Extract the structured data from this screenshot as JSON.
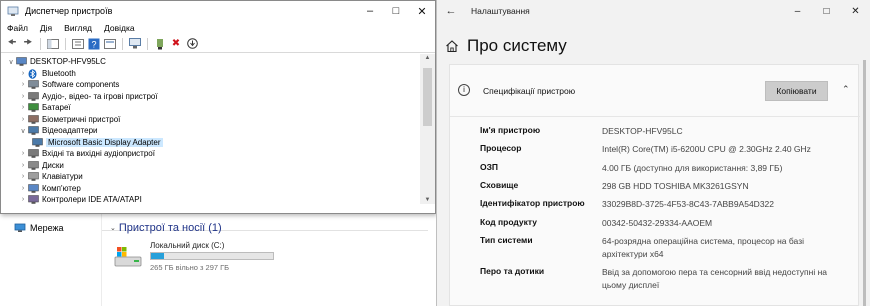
{
  "device_manager": {
    "title": "Диспетчер пристроїв",
    "menu": [
      "Файл",
      "Дія",
      "Вигляд",
      "Довідка"
    ],
    "tree": {
      "root": "DESKTOP-HFV95LC",
      "items": [
        {
          "label": "Bluetooth",
          "icon": "bluetooth-icon",
          "expanded": false
        },
        {
          "label": "Software components",
          "icon": "component-icon",
          "expanded": false
        },
        {
          "label": "Аудіо-, відео- та ігрові пристрої",
          "icon": "speaker-icon",
          "expanded": false
        },
        {
          "label": "Батареї",
          "icon": "battery-icon",
          "expanded": false
        },
        {
          "label": "Біометричні пристрої",
          "icon": "fingerprint-icon",
          "expanded": false
        },
        {
          "label": "Відеоадаптери",
          "icon": "display-adapter-icon",
          "expanded": true
        },
        {
          "label": "Microsoft Basic Display Adapter",
          "icon": "display-adapter-icon",
          "child": true,
          "selected": true
        },
        {
          "label": "Вхідні та вихідні аудіопристрої",
          "icon": "speaker-icon",
          "expanded": false
        },
        {
          "label": "Диски",
          "icon": "disk-icon",
          "expanded": false
        },
        {
          "label": "Клавіатури",
          "icon": "keyboard-icon",
          "expanded": false
        },
        {
          "label": "Комп'ютер",
          "icon": "computer-icon",
          "expanded": false
        },
        {
          "label": "Контролери IDE ATA/ATAPI",
          "icon": "controller-icon",
          "expanded": false
        }
      ]
    }
  },
  "explorer": {
    "nav_network": "Мережа",
    "group_title": "Пристрої та носії (1)",
    "drive": {
      "name": "Локальний диск (C:)",
      "free_text": "265 ГБ вільно з 297 ГБ",
      "used_fraction": 0.108
    }
  },
  "settings": {
    "window_title": "Налаштування",
    "page_title": "Про систему",
    "spec_title": "Специфікації пристрою",
    "copy_button": "Копіювати",
    "specs": [
      {
        "key": "Ім'я пристрою",
        "value": "DESKTOP-HFV95LC"
      },
      {
        "key": "Процесор",
        "value": "Intel(R) Core(TM) i5-6200U CPU @ 2.30GHz   2.40 GHz"
      },
      {
        "key": "ОЗП",
        "value": "4.00 ГБ (доступно для використання: 3,89 ГБ)"
      },
      {
        "key": "Сховище",
        "value": "298 GB HDD TOSHIBA MK3261GSYN"
      },
      {
        "key": "Ідентифікатор пристрою",
        "value": "33029B8D-3725-4F53-8C43-7ABB9A54D322"
      },
      {
        "key": "Код продукту",
        "value": "00342-50432-29334-AAOEM"
      },
      {
        "key": "Тип системи",
        "value": "64-розрядна операційна система, процесор на базі архітектури x64"
      },
      {
        "key": "Перо та дотики",
        "value": "Ввід за допомогою пера та сенсорний ввід недоступні на цьому дисплеї"
      }
    ]
  },
  "colors": {
    "selection": "#cce8ff",
    "drive_bar": "#26a0da",
    "group_title": "#1e3287"
  }
}
